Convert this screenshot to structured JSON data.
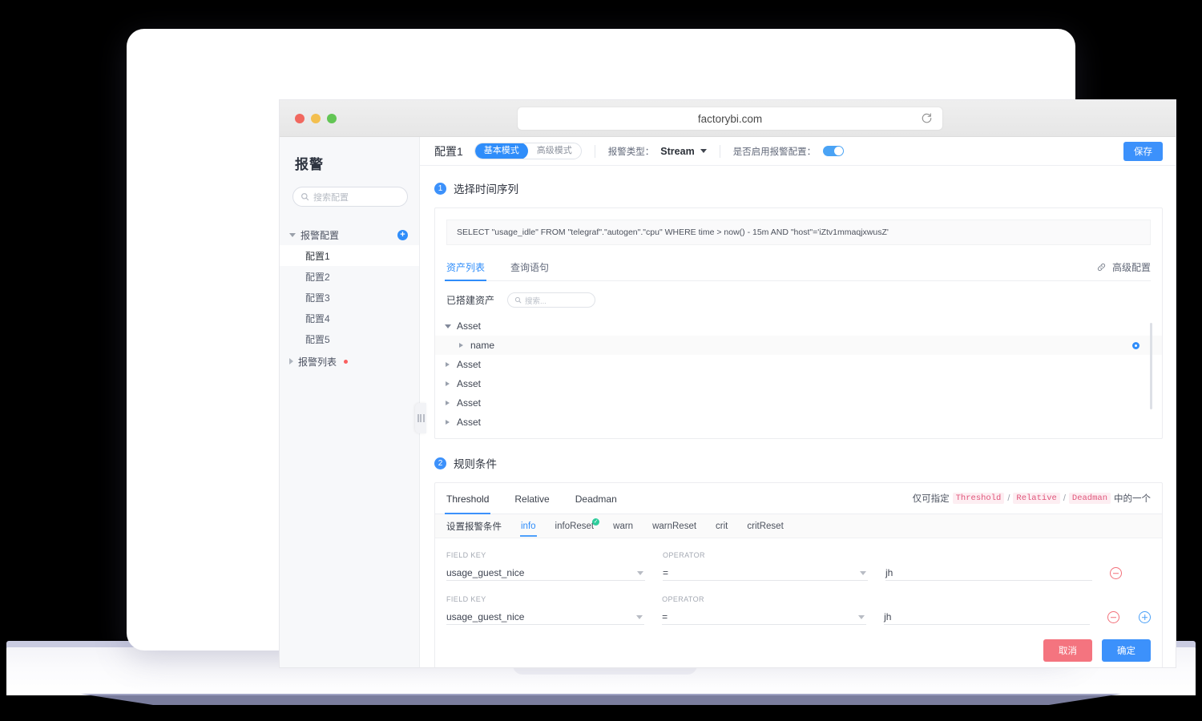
{
  "browser": {
    "url": "factorybi.com",
    "reload_icon": "reload-icon"
  },
  "sidebar": {
    "title": "报警",
    "search_placeholder": "搜索配置",
    "search_icon": "search-icon",
    "group": {
      "label": "报警配置",
      "add_label": "+"
    },
    "items": [
      {
        "label": "配置1",
        "active": true
      },
      {
        "label": "配置2",
        "active": false
      },
      {
        "label": "配置3",
        "active": false
      },
      {
        "label": "配置4",
        "active": false
      },
      {
        "label": "配置5",
        "active": false
      }
    ],
    "second_group": {
      "label": "报警列表",
      "has_dot": true
    }
  },
  "toolbar": {
    "config_name": "配置1",
    "mode_basic": "基本模式",
    "mode_advanced": "高级模式",
    "alarm_type_label": "报警类型：",
    "alarm_type_value": "Stream",
    "enable_label": "是否启用报警配置：",
    "enabled": true,
    "save_label": "保存"
  },
  "step1": {
    "number": "1",
    "title": "选择时间序列",
    "sql": "SELECT \"usage_idle\" FROM \"telegraf\".\"autogen\".\"cpu\" WHERE time > now() - 15m AND \"host\"='iZtv1mmaqjxwusZ'",
    "tabs": [
      {
        "label": "资产列表",
        "active": true
      },
      {
        "label": "查询语句",
        "active": false
      }
    ],
    "advanced_link": "高级配置",
    "asset_header": "已搭建资产",
    "asset_search_placeholder": "搜索...",
    "tree": [
      {
        "label": "Asset",
        "level": 0,
        "expanded": true,
        "selected": false
      },
      {
        "label": "name",
        "level": 1,
        "expanded": false,
        "selected": true
      },
      {
        "label": "Asset",
        "level": 0,
        "expanded": false,
        "selected": false
      },
      {
        "label": "Asset",
        "level": 0,
        "expanded": false,
        "selected": false
      },
      {
        "label": "Asset",
        "level": 0,
        "expanded": false,
        "selected": false
      },
      {
        "label": "Asset",
        "level": 0,
        "expanded": false,
        "selected": false
      }
    ]
  },
  "step2": {
    "number": "2",
    "title": "规则条件",
    "tabs": [
      {
        "label": "Threshold",
        "active": true
      },
      {
        "label": "Relative",
        "active": false
      },
      {
        "label": "Deadman",
        "active": false
      }
    ],
    "hint_prefix": "仅可指定",
    "hint_codes": [
      "Threshold",
      "Relative",
      "Deadman"
    ],
    "hint_suffix": "中的一个",
    "cond_label": "设置报警条件",
    "cond_tabs": [
      {
        "label": "info",
        "active": true,
        "badge": false
      },
      {
        "label": "infoReset",
        "active": false,
        "badge": true
      },
      {
        "label": "warn",
        "active": false,
        "badge": false
      },
      {
        "label": "warnReset",
        "active": false,
        "badge": false
      },
      {
        "label": "crit",
        "active": false,
        "badge": false
      },
      {
        "label": "critReset",
        "active": false,
        "badge": false
      }
    ],
    "caption_field_key": "FIELD KEY",
    "caption_operator": "OPERATOR",
    "rows": [
      {
        "field_key": "usage_guest_nice",
        "operator": "=",
        "value": "jh",
        "has_add": false
      },
      {
        "field_key": "usage_guest_nice",
        "operator": "=",
        "value": "jh",
        "has_add": true
      }
    ],
    "cancel_label": "取消",
    "ok_label": "确定"
  },
  "colors": {
    "accent": "#3c91fb",
    "danger": "#f4747f",
    "ok": "#2ecc9b",
    "code": "#e0557a"
  }
}
